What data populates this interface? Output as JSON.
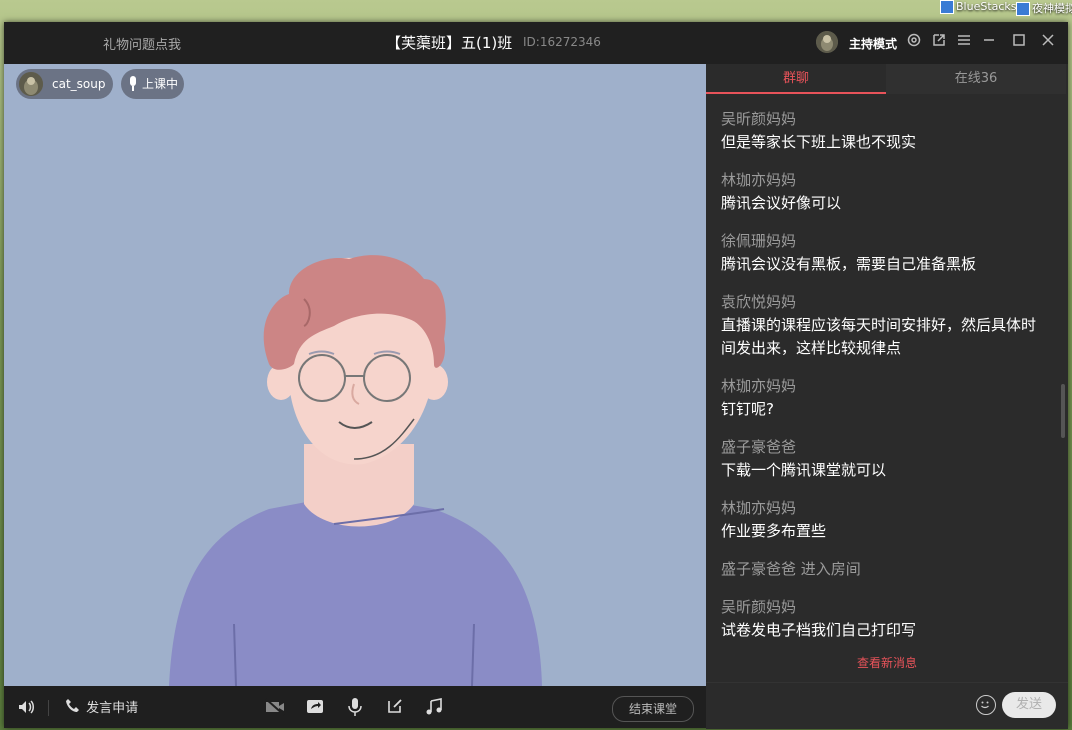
{
  "desktop": {
    "icons": [
      "BlueStacks",
      "夜神模拟器"
    ]
  },
  "titlebar": {
    "left_text": "礼物问题点我",
    "title": "【芙蕖班】五(1)班",
    "room_id": "ID:16272346",
    "mode_label": "主持模式"
  },
  "stage": {
    "user_name": "cat_soup",
    "status": "上课中"
  },
  "toolbar": {
    "apply_speak": "发言申请",
    "end_class": "结束课堂"
  },
  "panel": {
    "tabs": [
      {
        "label": "群聊"
      },
      {
        "label": "在线36"
      }
    ],
    "messages": [
      {
        "name": "吴昕颜妈妈",
        "text": "但是等家长下班上课也不现实"
      },
      {
        "name": "林珈亦妈妈",
        "text": "腾讯会议好像可以"
      },
      {
        "name": "徐佩珊妈妈",
        "text": "腾讯会议没有黑板，需要自己准备黑板"
      },
      {
        "name": "袁欣悦妈妈",
        "text": "直播课的课程应该每天时间安排好，然后具体时间发出来，这样比较规律点"
      },
      {
        "name": "林珈亦妈妈",
        "text": "钉钉呢?"
      },
      {
        "name": "盛子豪爸爸",
        "text": "下载一个腾讯课堂就可以"
      },
      {
        "name": "林珈亦妈妈",
        "text": "作业要多布置些"
      },
      {
        "name": "盛子豪爸爸 进入房间",
        "text": ""
      },
      {
        "name": "吴昕颜妈妈",
        "text": "试卷发电子档我们自己打印写"
      }
    ],
    "new_messages": "查看新消息",
    "send_label": "发送",
    "input_placeholder": ""
  }
}
